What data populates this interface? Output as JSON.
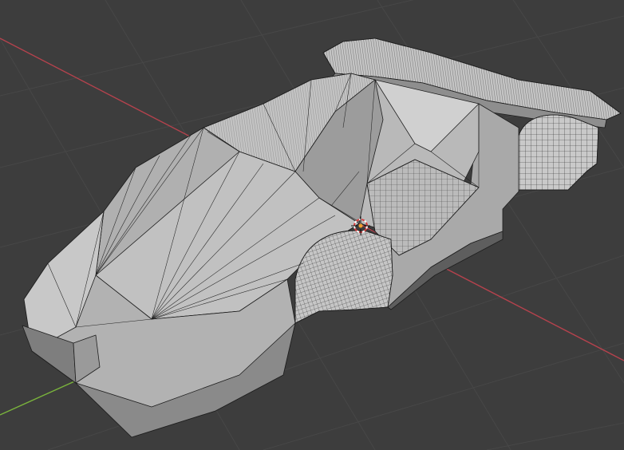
{
  "app": "3D viewport",
  "viewport": {
    "background_color": "#3d3d3d",
    "grid_color": "#4a4a4a",
    "x_axis_color": "#b5424d",
    "y_axis_color": "#7ab43c",
    "mesh_face_color": "#b8b8b8",
    "mesh_shadow_color": "#6a6a6a",
    "wire_color": "#1e1e1e",
    "cursor_color": "#d23c3c"
  },
  "scene": {
    "object": "car-body-mesh",
    "shading": "solid",
    "overlay": "wireframe",
    "icons": [
      "3d-cursor-icon"
    ]
  }
}
